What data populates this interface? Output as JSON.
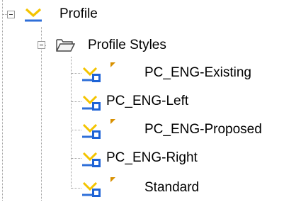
{
  "tree": {
    "root": {
      "label": "Profile",
      "icon": "profile-icon",
      "expanded": true,
      "children": [
        {
          "label": "Profile Styles",
          "icon": "folder-open-icon",
          "expanded": true,
          "children": [
            {
              "label": "PC_ENG-Existing",
              "icon": "profile-style-icon",
              "flagged": true
            },
            {
              "label": "PC_ENG-Left",
              "icon": "profile-style-icon",
              "flagged": false
            },
            {
              "label": "PC_ENG-Proposed",
              "icon": "profile-style-icon",
              "flagged": true
            },
            {
              "label": "PC_ENG-Right",
              "icon": "profile-style-icon",
              "flagged": false
            },
            {
              "label": "Standard",
              "icon": "profile-style-icon",
              "flagged": true
            }
          ]
        }
      ]
    }
  },
  "colors": {
    "profile_icon_yellow": "#f4c400",
    "profile_icon_blue": "#2f6fd8",
    "style_badge_blue": "#1e63d6",
    "flag_orange": "#d89000",
    "tree_lines": "#a0a0a0"
  }
}
